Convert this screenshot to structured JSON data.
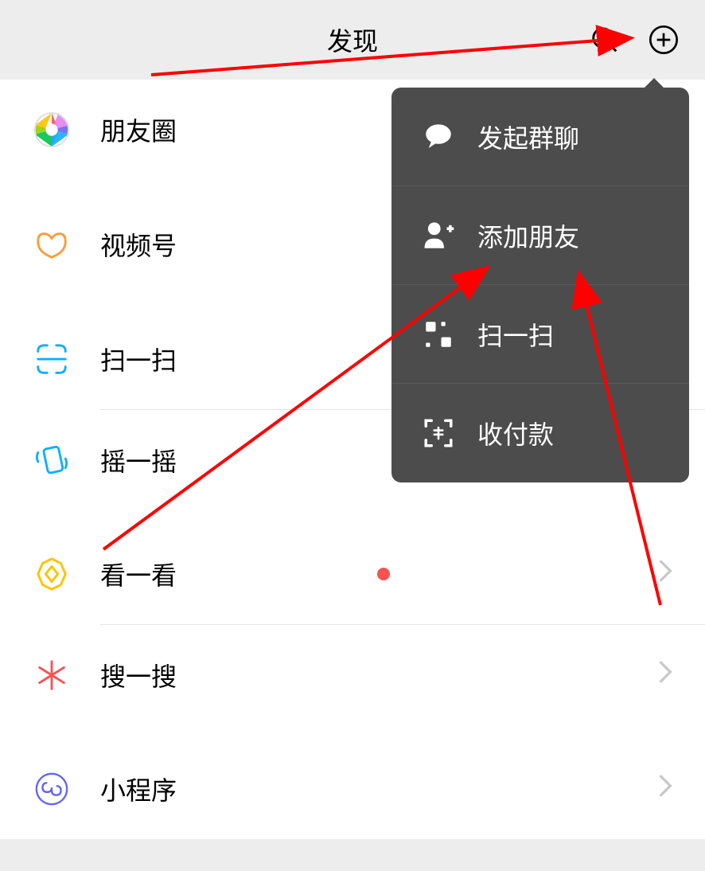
{
  "header": {
    "title": "发现"
  },
  "list": {
    "moments": "朋友圈",
    "channels": "视频号",
    "scan": "扫一扫",
    "shake": "摇一摇",
    "topstories": "看一看",
    "search": "搜一搜",
    "miniprogram": "小程序"
  },
  "popup": {
    "group_chat": "发起群聊",
    "add_friend": "添加朋友",
    "scan": "扫一扫",
    "payment": "收付款"
  }
}
